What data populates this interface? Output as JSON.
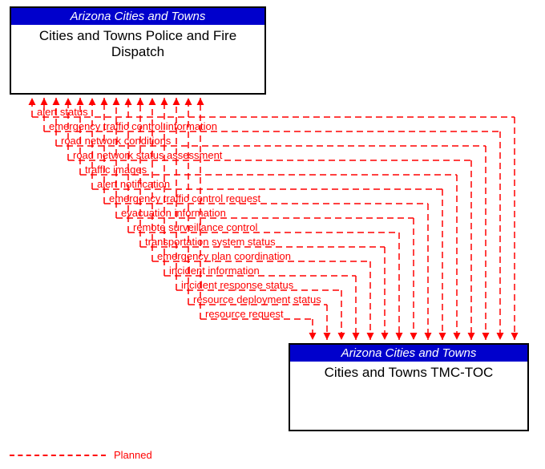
{
  "entities": {
    "top": {
      "header": "Arizona Cities and Towns",
      "body": "Cities and Towns Police and Fire Dispatch"
    },
    "bottom": {
      "header": "Arizona Cities and Towns",
      "body": "Cities and Towns TMC-TOC"
    }
  },
  "flows": [
    {
      "label": "alert status"
    },
    {
      "label": "emergency traffic control information"
    },
    {
      "label": "road network conditions"
    },
    {
      "label": "road network status assessment"
    },
    {
      "label": "traffic images"
    },
    {
      "label": "alert notification"
    },
    {
      "label": "emergency traffic control request"
    },
    {
      "label": "evacuation information"
    },
    {
      "label": "remote surveillance control"
    },
    {
      "label": "transportation system status"
    },
    {
      "label": "emergency plan coordination"
    },
    {
      "label": "incident information"
    },
    {
      "label": "incident response status"
    },
    {
      "label": "resource deployment status"
    },
    {
      "label": "resource request"
    }
  ],
  "legend": {
    "planned": "Planned"
  },
  "chart_data": {
    "type": "flow-diagram",
    "source_entity": "Cities and Towns TMC-TOC",
    "target_entity": "Cities and Towns Police and Fire Dispatch",
    "bidirectional_flows": [
      "alert status",
      "emergency traffic control information",
      "road network conditions",
      "road network status assessment",
      "traffic images",
      "alert notification",
      "emergency traffic control request",
      "evacuation information",
      "remote surveillance control",
      "transportation system status",
      "emergency plan coordination",
      "incident information",
      "incident response status",
      "resource deployment status",
      "resource request"
    ],
    "status": "Planned"
  }
}
